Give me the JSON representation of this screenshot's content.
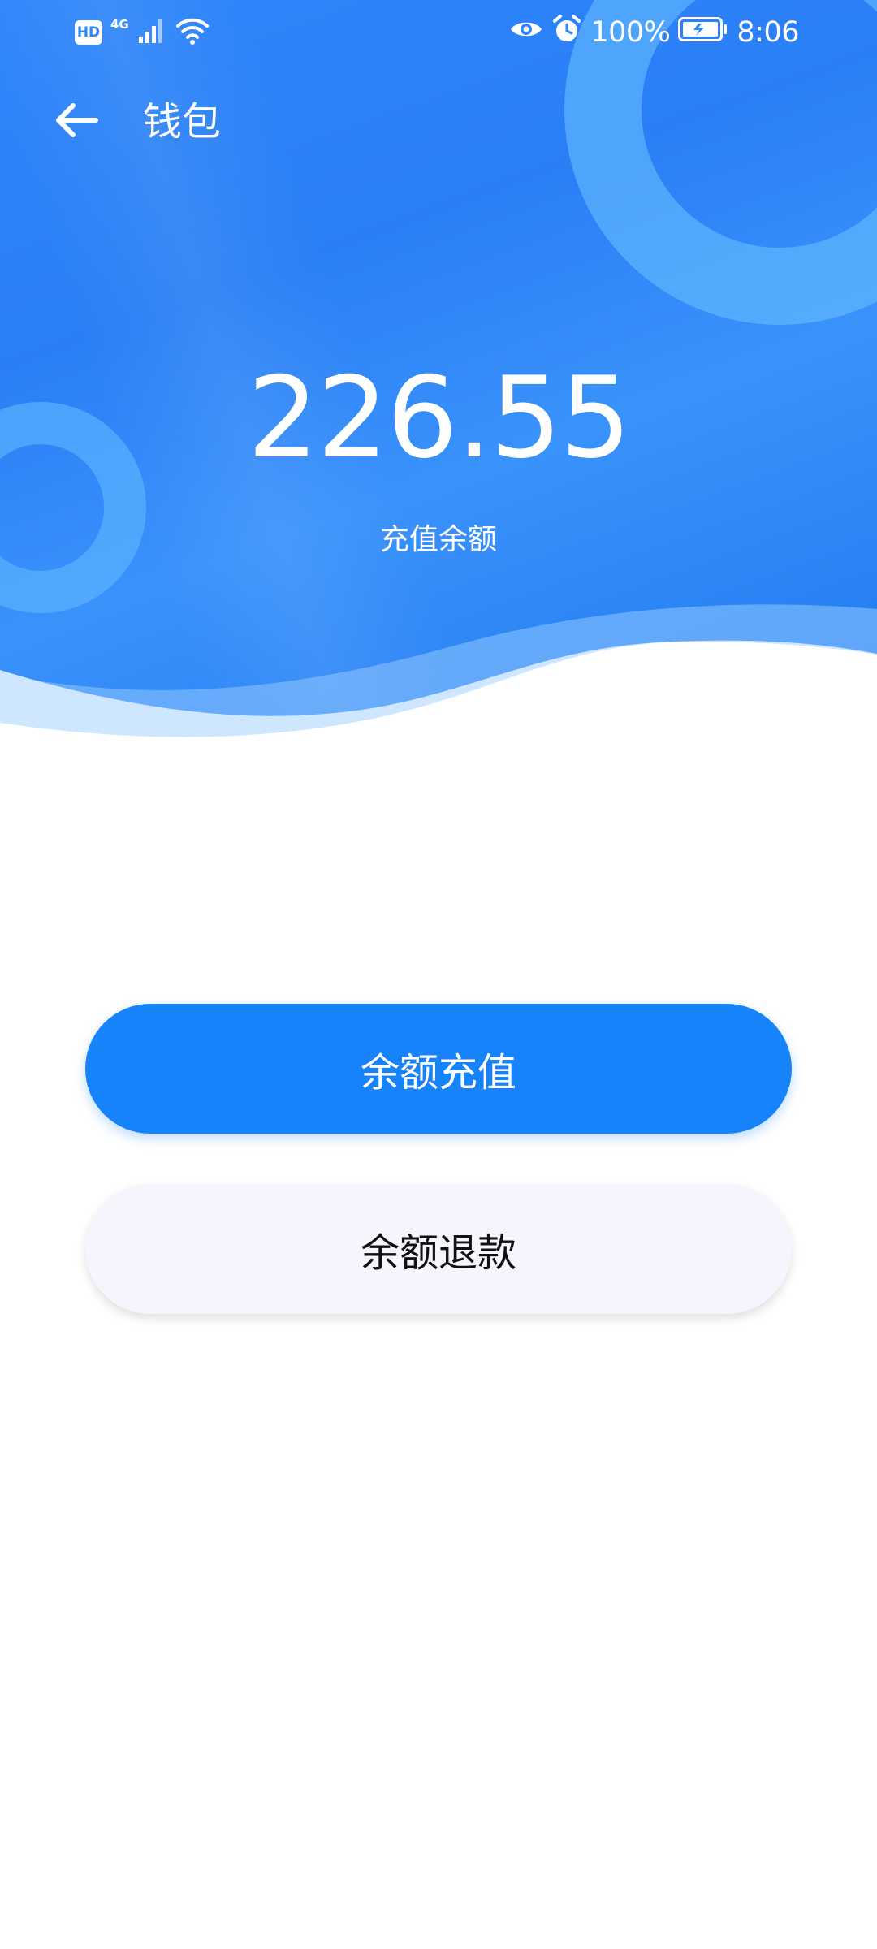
{
  "status_bar": {
    "hd": "HD",
    "network": "4G",
    "battery_percent": "100%",
    "time": "8:06"
  },
  "header": {
    "title": "钱包"
  },
  "balance": {
    "amount": "226.55",
    "label": "充值余额"
  },
  "actions": {
    "recharge_label": "余额充值",
    "refund_label": "余额退款"
  },
  "colors": {
    "primary": "#1783fb",
    "hero_blue": "#2f86fb",
    "secondary_button_bg": "#f5f6fd"
  }
}
